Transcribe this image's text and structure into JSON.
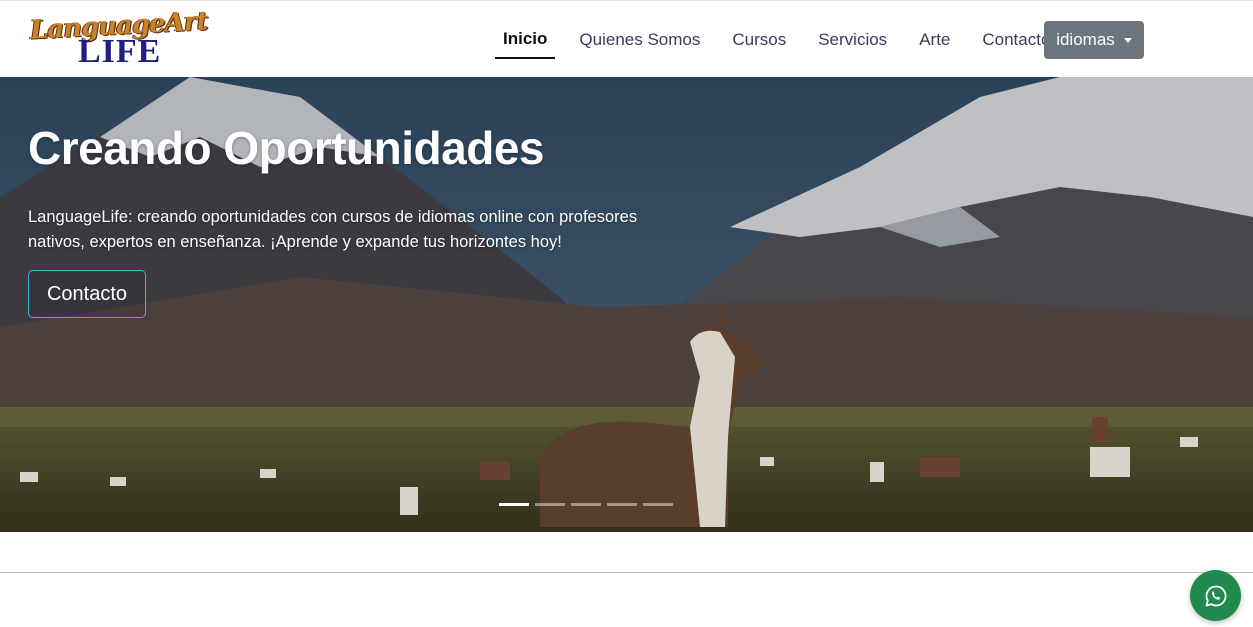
{
  "brand": {
    "logo_top": "LanguageArt",
    "logo_bottom": "LIFE"
  },
  "nav": {
    "items": [
      {
        "label": "Inicio",
        "active": true
      },
      {
        "label": "Quienes Somos"
      },
      {
        "label": "Cursos"
      },
      {
        "label": "Servicios"
      },
      {
        "label": "Arte"
      },
      {
        "label": "Contacto"
      }
    ],
    "language_button": "idiomas"
  },
  "hero": {
    "title": "Creando Oportunidades",
    "text": "LanguageLife: creando oportunidades con cursos de idiomas online con profesores nativos, expertos en enseñanza. ¡Aprende y expande tus horizontes hoy!",
    "button": "Contacto",
    "slide_count": 5,
    "active_slide": 1
  },
  "floating": {
    "icon": "whatsapp-icon"
  },
  "colors": {
    "language_button": "#6c757d",
    "hero_button_border": "#3bb3d9",
    "whatsapp": "#1f8a4c",
    "logo_orange": "#c9832a",
    "logo_blue": "#1f1f80"
  }
}
